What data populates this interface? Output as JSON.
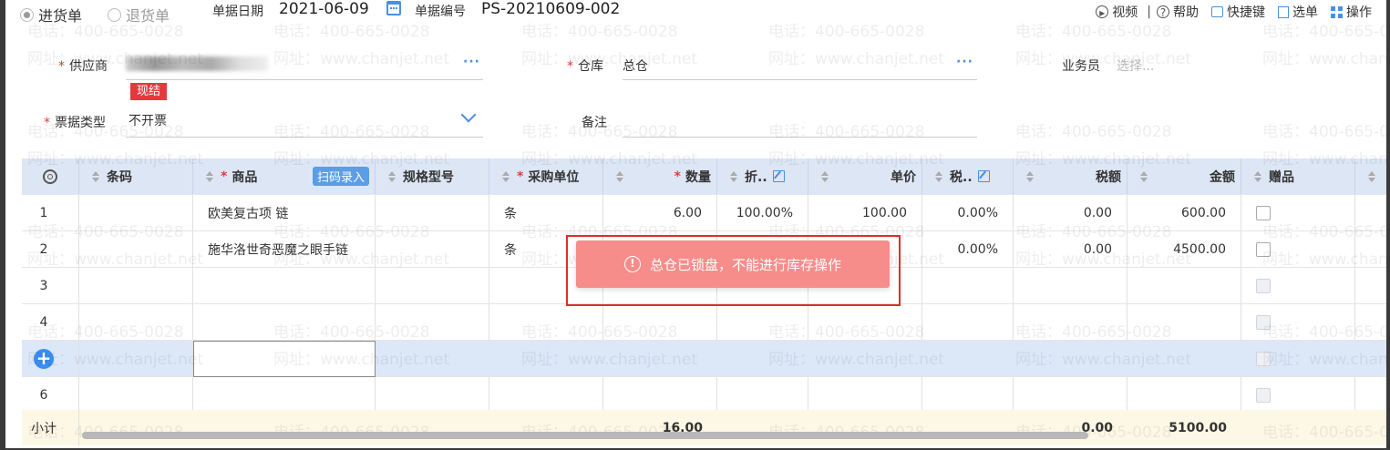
{
  "bill_type_radio": {
    "purchase": "进货单",
    "return": "退货单"
  },
  "header": {
    "date_label": "单据日期",
    "date_value": "2021-06-09",
    "number_label": "单据编号",
    "number_value": "PS-20210609-002"
  },
  "toolbar": {
    "video": "视频",
    "help": "帮助",
    "shortcut": "快捷键",
    "select_order": "选单",
    "operations": "操作",
    "divider": "|"
  },
  "form": {
    "supplier_label": "供应商",
    "settlement_badge": "现结",
    "warehouse_label": "仓库",
    "warehouse_value": "总仓",
    "salesperson_label": "业务员",
    "salesperson_placeholder": "选择...",
    "invoice_type_label": "票据类型",
    "invoice_type_value": "不开票",
    "remark_label": "备注",
    "required_mark": "*",
    "more_dots": "···"
  },
  "table": {
    "columns": {
      "barcode": "条码",
      "product": "商品",
      "scan_button": "扫码录入",
      "spec": "规格型号",
      "unit": "采购单位",
      "qty": "数量",
      "discount": "折..",
      "price": "单价",
      "tax_rate": "税..",
      "tax": "税额",
      "amount": "金额",
      "gift": "赠品"
    },
    "rows": [
      {
        "no": "1",
        "product": "欧美复古项 链",
        "unit": "条",
        "qty": "6.00",
        "discount": "100.00%",
        "price": "100.00",
        "tax_rate": "0.00%",
        "tax": "0.00",
        "amount": "600.00"
      },
      {
        "no": "2",
        "product": "施华洛世奇恶魔之眼手链",
        "unit": "条",
        "qty": "",
        "discount": "",
        "price": "",
        "tax_rate": "0.00%",
        "tax": "0.00",
        "amount": "4500.00"
      },
      {
        "no": "3"
      },
      {
        "no": "4"
      },
      {
        "no": ""
      },
      {
        "no": "6"
      }
    ],
    "subtotal": {
      "label": "小计",
      "qty": "16.00",
      "tax": "0.00",
      "amount": "5100.00"
    }
  },
  "toast": {
    "message": "总仓已锁盘，不能进行库存操作",
    "icon": "warning-icon"
  },
  "watermark": {
    "phone": "电话：400-665-0028",
    "site": "网址：www.chanjet.net"
  },
  "colors": {
    "accent": "#4a90e2",
    "required": "#e4393c",
    "toast_bg": "#f68d8a",
    "header_bg": "#dde6f4",
    "selected_row": "#dce8f8",
    "subtotal_bg": "#fdf8e6"
  }
}
